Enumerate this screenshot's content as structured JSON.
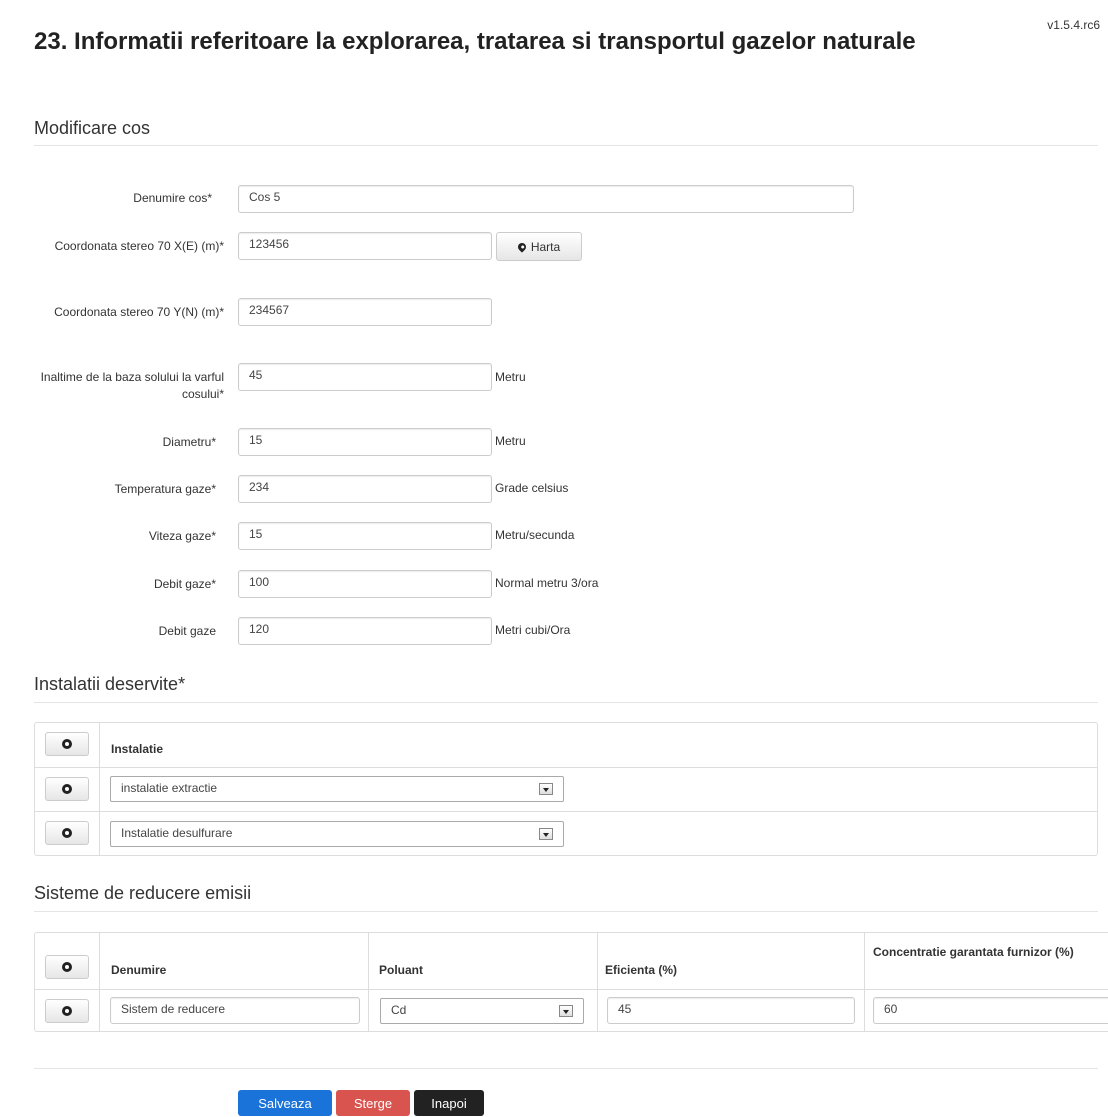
{
  "version": "v1.5.4.rc6",
  "title": "23. Informatii referitoare la explorarea, tratarea si transportul gazelor naturale",
  "subtitle": "Modificare cos",
  "form": {
    "fields": [
      {
        "label": "Denumire cos*",
        "value": "Cos 5",
        "unit": ""
      },
      {
        "label": "Coordonata stereo 70 X(E) (m)*",
        "value": "123456",
        "unit": ""
      },
      {
        "label": "Coordonata stereo 70 Y(N) (m)*",
        "value": "234567",
        "unit": ""
      },
      {
        "label": "Inaltime de la baza solului la varful cosului*",
        "value": "45",
        "unit": "Metru"
      },
      {
        "label": "Diametru*",
        "value": "15",
        "unit": "Metru"
      },
      {
        "label": "Temperatura gaze*",
        "value": "234",
        "unit": "Grade celsius"
      },
      {
        "label": "Viteza gaze*",
        "value": "15",
        "unit": "Metru/secunda"
      },
      {
        "label": "Debit gaze*",
        "value": "100",
        "unit": "Normal metru 3/ora"
      },
      {
        "label": "Debit gaze",
        "value": "120",
        "unit": "Metri cubi/Ora"
      }
    ],
    "map_button": {
      "label": "Harta",
      "icon": "map-marker-icon"
    }
  },
  "installations": {
    "title": "Instalatii deservite*",
    "header": "Instalatie",
    "rows": [
      "instalatie extractie",
      "Instalatie desulfurare"
    ]
  },
  "reduction": {
    "title": "Sisteme de reducere emisii",
    "headers": [
      "Denumire",
      "Poluant",
      "Eficienta (%)",
      "Concentratie garantata furnizor (%)"
    ],
    "row": {
      "denumire": "Sistem de reducere",
      "poluant": "Cd",
      "eficienta": "45",
      "concentratie": "60"
    }
  },
  "actions": {
    "save": "Salveaza",
    "delete": "Sterge",
    "back": "Inapoi",
    "save_color": "#1a73d9",
    "delete_color": "#d9534f",
    "back_color": "#222222"
  }
}
